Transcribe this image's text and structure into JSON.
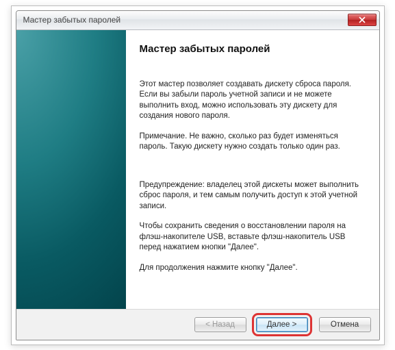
{
  "window": {
    "title": "Мастер забытых паролей"
  },
  "content": {
    "heading": "Мастер забытых паролей",
    "p1": "Этот мастер позволяет создавать дискету сброса пароля. Если вы забыли пароль учетной записи и не можете выполнить вход, можно использовать эту дискету для создания нового пароля.",
    "p2": "Примечание. Не важно, сколько раз будет изменяться пароль. Такую дискету нужно создать только один раз.",
    "p3": "Предупреждение: владелец этой дискеты может выполнить сброс пароля, и тем самым получить доступ к этой учетной записи.",
    "p4": "Чтобы сохранить сведения о восстановлении пароля на флэш-накопителе USB, вставьте флэш-накопитель USB перед нажатием кнопки \"Далее\".",
    "p5": "Для продолжения нажмите кнопку \"Далее\"."
  },
  "buttons": {
    "back": "< Назад",
    "next": "Далее >",
    "cancel": "Отмена"
  }
}
